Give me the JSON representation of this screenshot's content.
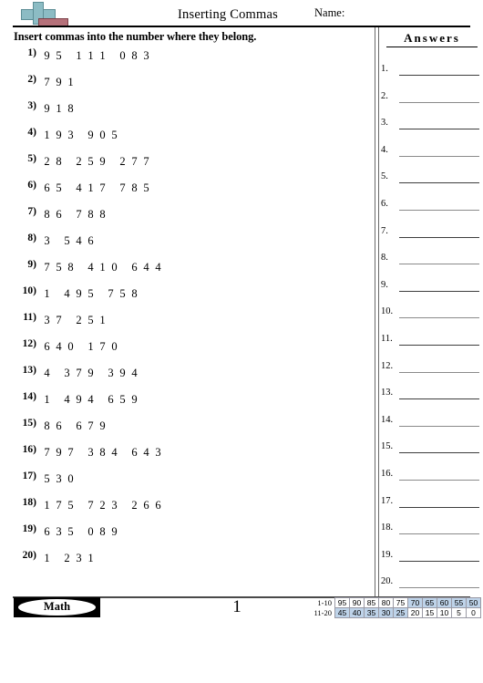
{
  "header": {
    "title": "Inserting Commas",
    "name_label": "Name:",
    "logo_icon": "plus-logo-icon",
    "logo_plus_color": "#8cbcc4",
    "logo_bar_color": "#b5717a"
  },
  "instructions": "Insert commas into the number where they belong.",
  "answers": {
    "heading": "Answers",
    "items": [
      {
        "number": "1."
      },
      {
        "number": "2."
      },
      {
        "number": "3."
      },
      {
        "number": "4."
      },
      {
        "number": "5."
      },
      {
        "number": "6."
      },
      {
        "number": "7."
      },
      {
        "number": "8."
      },
      {
        "number": "9."
      },
      {
        "number": "10."
      },
      {
        "number": "11."
      },
      {
        "number": "12."
      },
      {
        "number": "13."
      },
      {
        "number": "14."
      },
      {
        "number": "15."
      },
      {
        "number": "16."
      },
      {
        "number": "17."
      },
      {
        "number": "18."
      },
      {
        "number": "19."
      },
      {
        "number": "20."
      }
    ]
  },
  "problems": [
    {
      "number": "1)",
      "digits": "95111083",
      "groups": [
        [
          "9",
          "5"
        ],
        [
          "1",
          "1",
          "1"
        ],
        [
          "0",
          "8",
          "3"
        ]
      ]
    },
    {
      "number": "2)",
      "digits": "791",
      "groups": [
        [
          "7",
          "9",
          "1"
        ]
      ]
    },
    {
      "number": "3)",
      "digits": "918",
      "groups": [
        [
          "9",
          "1",
          "8"
        ]
      ]
    },
    {
      "number": "4)",
      "digits": "193905",
      "groups": [
        [
          "1",
          "9",
          "3"
        ],
        [
          "9",
          "0",
          "5"
        ]
      ]
    },
    {
      "number": "5)",
      "digits": "28259277",
      "groups": [
        [
          "2",
          "8"
        ],
        [
          "2",
          "5",
          "9"
        ],
        [
          "2",
          "7",
          "7"
        ]
      ]
    },
    {
      "number": "6)",
      "digits": "65417785",
      "groups": [
        [
          "6",
          "5"
        ],
        [
          "4",
          "1",
          "7"
        ],
        [
          "7",
          "8",
          "5"
        ]
      ]
    },
    {
      "number": "7)",
      "digits": "86788",
      "groups": [
        [
          "8",
          "6"
        ],
        [
          "7",
          "8",
          "8"
        ]
      ]
    },
    {
      "number": "8)",
      "digits": "3546",
      "groups": [
        [
          "3"
        ],
        [
          "5",
          "4",
          "6"
        ]
      ]
    },
    {
      "number": "9)",
      "digits": "758410644",
      "groups": [
        [
          "7",
          "5",
          "8"
        ],
        [
          "4",
          "1",
          "0"
        ],
        [
          "6",
          "4",
          "4"
        ]
      ]
    },
    {
      "number": "10)",
      "digits": "1495758",
      "groups": [
        [
          "1"
        ],
        [
          "4",
          "9",
          "5"
        ],
        [
          "7",
          "5",
          "8"
        ]
      ]
    },
    {
      "number": "11)",
      "digits": "37251",
      "groups": [
        [
          "3",
          "7"
        ],
        [
          "2",
          "5",
          "1"
        ]
      ]
    },
    {
      "number": "12)",
      "digits": "640170",
      "groups": [
        [
          "6",
          "4",
          "0"
        ],
        [
          "1",
          "7",
          "0"
        ]
      ]
    },
    {
      "number": "13)",
      "digits": "4379394",
      "groups": [
        [
          "4"
        ],
        [
          "3",
          "7",
          "9"
        ],
        [
          "3",
          "9",
          "4"
        ]
      ]
    },
    {
      "number": "14)",
      "digits": "1494659",
      "groups": [
        [
          "1"
        ],
        [
          "4",
          "9",
          "4"
        ],
        [
          "6",
          "5",
          "9"
        ]
      ]
    },
    {
      "number": "15)",
      "digits": "86679",
      "groups": [
        [
          "8",
          "6"
        ],
        [
          "6",
          "7",
          "9"
        ]
      ]
    },
    {
      "number": "16)",
      "digits": "797384643",
      "groups": [
        [
          "7",
          "9",
          "7"
        ],
        [
          "3",
          "8",
          "4"
        ],
        [
          "6",
          "4",
          "3"
        ]
      ]
    },
    {
      "number": "17)",
      "digits": "530",
      "groups": [
        [
          "5",
          "3",
          "0"
        ]
      ]
    },
    {
      "number": "18)",
      "digits": "175723266",
      "groups": [
        [
          "1",
          "7",
          "5"
        ],
        [
          "7",
          "2",
          "3"
        ],
        [
          "2",
          "6",
          "6"
        ]
      ]
    },
    {
      "number": "19)",
      "digits": "635089",
      "groups": [
        [
          "6",
          "3",
          "5"
        ],
        [
          "0",
          "8",
          "9"
        ]
      ]
    },
    {
      "number": "20)",
      "digits": "1231",
      "groups": [
        [
          "1"
        ],
        [
          "2",
          "3",
          "1"
        ]
      ]
    }
  ],
  "footer": {
    "brand": "Math",
    "page_number": "1"
  },
  "score_table": {
    "shade_color": "#bed3e9",
    "rows": [
      {
        "label": "1-10",
        "cells": [
          {
            "value": "95",
            "shaded": false
          },
          {
            "value": "90",
            "shaded": false
          },
          {
            "value": "85",
            "shaded": false
          },
          {
            "value": "80",
            "shaded": false
          },
          {
            "value": "75",
            "shaded": false
          },
          {
            "value": "70",
            "shaded": true
          },
          {
            "value": "65",
            "shaded": true
          },
          {
            "value": "60",
            "shaded": true
          },
          {
            "value": "55",
            "shaded": true
          },
          {
            "value": "50",
            "shaded": true
          }
        ]
      },
      {
        "label": "11-20",
        "cells": [
          {
            "value": "45",
            "shaded": true
          },
          {
            "value": "40",
            "shaded": true
          },
          {
            "value": "35",
            "shaded": true
          },
          {
            "value": "30",
            "shaded": true
          },
          {
            "value": "25",
            "shaded": true
          },
          {
            "value": "20",
            "shaded": false
          },
          {
            "value": "15",
            "shaded": false
          },
          {
            "value": "10",
            "shaded": false
          },
          {
            "value": "5",
            "shaded": false
          },
          {
            "value": "0",
            "shaded": false
          }
        ]
      }
    ]
  }
}
